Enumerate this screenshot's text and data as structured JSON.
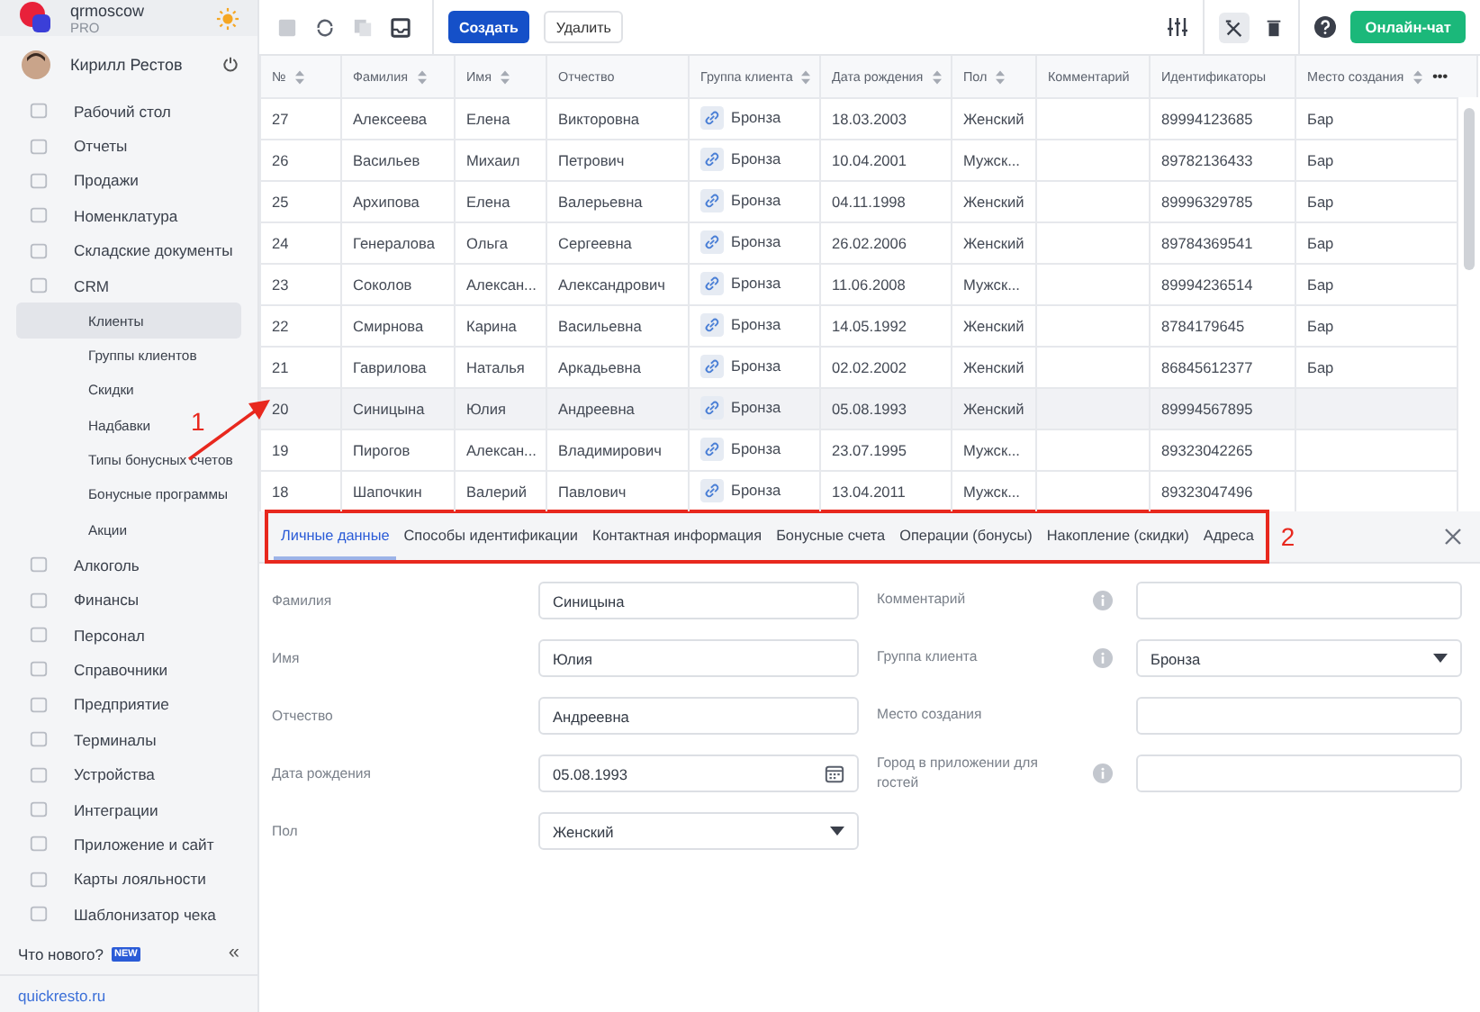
{
  "account": {
    "name": "qrmoscow",
    "plan": "PRO"
  },
  "user": {
    "name": "Кирилл Рестов"
  },
  "nav": [
    {
      "label": "Рабочий стол",
      "sub": false,
      "selected": false
    },
    {
      "label": "Отчеты",
      "sub": false,
      "selected": false
    },
    {
      "label": "Продажи",
      "sub": false,
      "selected": false
    },
    {
      "label": "Номенклатура",
      "sub": false,
      "selected": false
    },
    {
      "label": "Складские документы",
      "sub": false,
      "selected": false
    },
    {
      "label": "CRM",
      "sub": false,
      "selected": false
    },
    {
      "label": "Клиенты",
      "sub": true,
      "selected": true
    },
    {
      "label": "Группы клиентов",
      "sub": true,
      "selected": false
    },
    {
      "label": "Скидки",
      "sub": true,
      "selected": false
    },
    {
      "label": "Надбавки",
      "sub": true,
      "selected": false
    },
    {
      "label": "Типы бонусных счетов",
      "sub": true,
      "selected": false
    },
    {
      "label": "Бонусные программы",
      "sub": true,
      "selected": false
    },
    {
      "label": "Акции",
      "sub": true,
      "selected": false
    },
    {
      "label": "Алкоголь",
      "sub": false,
      "selected": false
    },
    {
      "label": "Финансы",
      "sub": false,
      "selected": false
    },
    {
      "label": "Персонал",
      "sub": false,
      "selected": false
    },
    {
      "label": "Справочники",
      "sub": false,
      "selected": false
    },
    {
      "label": "Предприятие",
      "sub": false,
      "selected": false
    },
    {
      "label": "Терминалы",
      "sub": false,
      "selected": false
    },
    {
      "label": "Устройства",
      "sub": false,
      "selected": false
    },
    {
      "label": "Интеграции",
      "sub": false,
      "selected": false
    },
    {
      "label": "Приложение и сайт",
      "sub": false,
      "selected": false
    },
    {
      "label": "Карты лояльности",
      "sub": false,
      "selected": false
    },
    {
      "label": "Шаблонизатор чека",
      "sub": false,
      "selected": false
    }
  ],
  "whats_new": {
    "label": "Что нового?",
    "badge": "NEW",
    "collapse": "«"
  },
  "site_link": "quickresto.ru",
  "toolbar": {
    "create": "Создать",
    "delete": "Удалить",
    "chat": "Онлайн-чат"
  },
  "table": {
    "columns": [
      {
        "label": "№",
        "sortable": true
      },
      {
        "label": "Фамилия",
        "sortable": true
      },
      {
        "label": "Имя",
        "sortable": true
      },
      {
        "label": "Отчество",
        "sortable": false
      },
      {
        "label": "Группа клиента",
        "sortable": true
      },
      {
        "label": "Дата рождения",
        "sortable": true
      },
      {
        "label": "Пол",
        "sortable": true
      },
      {
        "label": "Комментарий",
        "sortable": false
      },
      {
        "label": "Идентификаторы",
        "sortable": false
      },
      {
        "label": "Место создания",
        "sortable": true
      }
    ],
    "more": "•••",
    "rows": [
      {
        "selected": false,
        "cells": [
          "27",
          "Алексеева",
          "Елена",
          "Викторовна",
          "Бронза",
          "18.03.2003",
          "Женский",
          "",
          "89994123685",
          "Бар"
        ]
      },
      {
        "selected": false,
        "cells": [
          "26",
          "Васильев",
          "Михаил",
          "Петрович",
          "Бронза",
          "10.04.2001",
          "Мужск...",
          "",
          "89782136433",
          "Бар"
        ]
      },
      {
        "selected": false,
        "cells": [
          "25",
          "Архипова",
          "Елена",
          "Валерьевна",
          "Бронза",
          "04.11.1998",
          "Женский",
          "",
          "89996329785",
          "Бар"
        ]
      },
      {
        "selected": false,
        "cells": [
          "24",
          "Генералова",
          "Ольга",
          "Сергеевна",
          "Бронза",
          "26.02.2006",
          "Женский",
          "",
          "89784369541",
          "Бар"
        ]
      },
      {
        "selected": false,
        "cells": [
          "23",
          "Соколов",
          "Алексан...",
          "Александрович",
          "Бронза",
          "11.06.2008",
          "Мужск...",
          "",
          "89994236514",
          "Бар"
        ]
      },
      {
        "selected": false,
        "cells": [
          "22",
          "Смирнова",
          "Карина",
          "Васильевна",
          "Бронза",
          "14.05.1992",
          "Женский",
          "",
          "8784179645",
          "Бар"
        ]
      },
      {
        "selected": false,
        "cells": [
          "21",
          "Гаврилова",
          "Наталья",
          "Аркадьевна",
          "Бронза",
          "02.02.2002",
          "Женский",
          "",
          "86845612377",
          "Бар"
        ]
      },
      {
        "selected": true,
        "cells": [
          "20",
          "Синицына",
          "Юлия",
          "Андреевна",
          "Бронза",
          "05.08.1993",
          "Женский",
          "",
          "89994567895",
          ""
        ]
      },
      {
        "selected": false,
        "cells": [
          "19",
          "Пирогов",
          "Алексан...",
          "Владимирович",
          "Бронза",
          "23.07.1995",
          "Мужск...",
          "",
          "89323042265",
          ""
        ]
      },
      {
        "selected": false,
        "cells": [
          "18",
          "Шапочкин",
          "Валерий",
          "Павлович",
          "Бронза",
          "13.04.2011",
          "Мужск...",
          "",
          "89323047496",
          ""
        ]
      }
    ]
  },
  "tabs": [
    {
      "label": "Личные данные",
      "selected": true
    },
    {
      "label": "Способы идентификации",
      "selected": false
    },
    {
      "label": "Контактная информация",
      "selected": false
    },
    {
      "label": "Бонусные счета",
      "selected": false
    },
    {
      "label": "Операции (бонусы)",
      "selected": false
    },
    {
      "label": "Накопление (скидки)",
      "selected": false
    },
    {
      "label": "Адреса",
      "selected": false
    }
  ],
  "form_left": [
    {
      "label": "Фамилия",
      "kind": "text",
      "value": "Синицына"
    },
    {
      "label": "Имя",
      "kind": "text",
      "value": "Юлия"
    },
    {
      "label": "Отчество",
      "kind": "text",
      "value": "Андреевна"
    },
    {
      "label": "Дата рождения",
      "kind": "date",
      "value": "05.08.1993"
    },
    {
      "label": "Пол",
      "kind": "select",
      "value": "Женский"
    }
  ],
  "form_right": [
    {
      "label": "Комментарий",
      "kind": "text",
      "info": true
    },
    {
      "label": "Группа клиента",
      "kind": "select",
      "info": true,
      "value": "Бронза"
    },
    {
      "label": "Место создания",
      "kind": "text",
      "info": false
    },
    {
      "label": "Город в приложении для гостей",
      "kind": "text",
      "info": true
    }
  ],
  "annotations": [
    "1",
    "2"
  ]
}
